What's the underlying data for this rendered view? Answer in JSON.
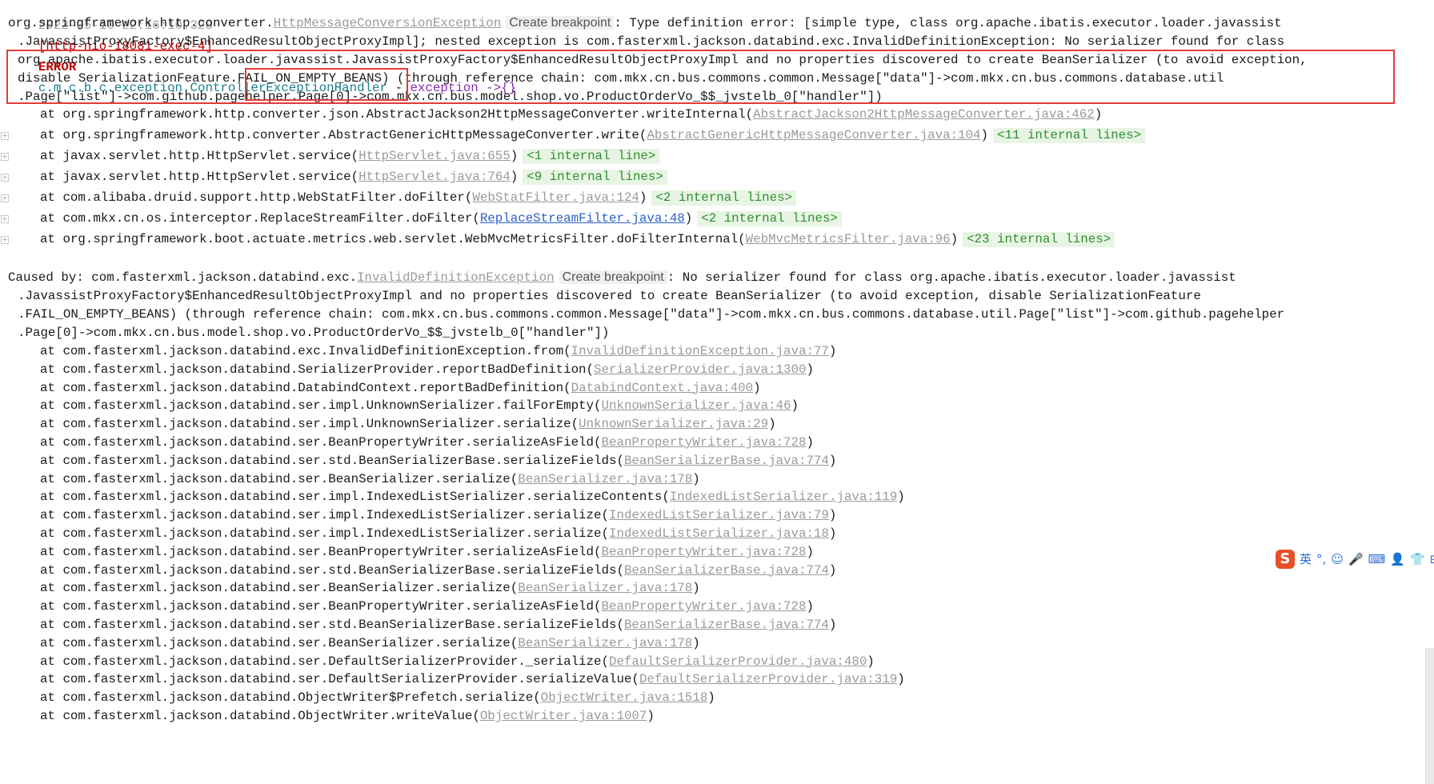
{
  "log_header": {
    "timestamp": "2022-05-10 22:16:10.328",
    "thread": "[http-nio-18081-exec-4]",
    "level": "ERROR",
    "logger": "c.m.c.b.c.exception.ControllerExceptionHandler",
    "separator": " - ",
    "message": "exception ->{}"
  },
  "exception": {
    "prefix": "org.springframework.http.converter.",
    "class_link": "HttpMessageConversionException",
    "create_breakpoint": "Create breakpoint",
    "line1_rest": ": Type definition error: [simple type, class org.apache.ibatis.executor.loader.javassist",
    "line2": ".JavassistProxyFactory$EnhancedResultObjectProxyImpl]; nested exception is com.fasterxml.jackson.databind.exc.InvalidDefinitionException: No serializer found for class",
    "line3": "org.apache.ibatis.executor.loader.javassist.JavassistProxyFactory$EnhancedResultObjectProxyImpl and no properties discovered to create BeanSerializer (to avoid exception,",
    "line4_a": "disable SerializationFeature.",
    "line4_b": "FAIL_ON_EMPTY_BEANS)",
    "line4_c": " (through reference chain: com.mkx.cn.bus.commons.common.Message[\"data\"]->com.mkx.cn.bus.commons.database.util",
    "line5": ".Page[\"list\"]->com.github.pagehelper.Page[0]->com.mkx.cn.bus.model.shop.vo.ProductOrderVo_$$_jvstelb_0[\"handler\"])"
  },
  "stack1": [
    {
      "method": "at org.springframework.http.converter.json.AbstractJackson2HttpMessageConverter.writeInternal",
      "file": "AbstractJackson2HttpMessageConverter.java:462",
      "internal": ""
    },
    {
      "method": "at org.springframework.http.converter.AbstractGenericHttpMessageConverter.write",
      "file": "AbstractGenericHttpMessageConverter.java:104",
      "internal": "<11 internal lines>"
    },
    {
      "method": "at javax.servlet.http.HttpServlet.service",
      "file": "HttpServlet.java:655",
      "internal": "<1 internal line>"
    },
    {
      "method": "at javax.servlet.http.HttpServlet.service",
      "file": "HttpServlet.java:764",
      "internal": "<9 internal lines>"
    },
    {
      "method": "at com.alibaba.druid.support.http.WebStatFilter.doFilter",
      "file": "WebStatFilter.java:124",
      "internal": "<2 internal lines>"
    },
    {
      "method": "at com.mkx.cn.os.interceptor.ReplaceStreamFilter.doFilter",
      "file": "ReplaceStreamFilter.java:48",
      "internal": "<2 internal lines>"
    },
    {
      "method": "at org.springframework.boot.actuate.metrics.web.servlet.WebMvcMetricsFilter.doFilterInternal",
      "file": "WebMvcMetricsFilter.java:96",
      "internal": "<23 internal lines>"
    }
  ],
  "caused_by": {
    "prefix": "Caused by: com.fasterxml.jackson.databind.exc.",
    "class_link": "InvalidDefinitionException",
    "create_breakpoint": "Create breakpoint",
    "line1_rest": ": No serializer found for class org.apache.ibatis.executor.loader.javassist",
    "line2": ".JavassistProxyFactory$EnhancedResultObjectProxyImpl and no properties discovered to create BeanSerializer (to avoid exception, disable SerializationFeature",
    "line3": ".FAIL_ON_EMPTY_BEANS) (through reference chain: com.mkx.cn.bus.commons.common.Message[\"data\"]->com.mkx.cn.bus.commons.database.util.Page[\"list\"]->com.github.pagehelper",
    "line4": ".Page[0]->com.mkx.cn.bus.model.shop.vo.ProductOrderVo_$$_jvstelb_0[\"handler\"])"
  },
  "stack2": [
    {
      "method": "at com.fasterxml.jackson.databind.exc.InvalidDefinitionException.from",
      "file": "InvalidDefinitionException.java:77"
    },
    {
      "method": "at com.fasterxml.jackson.databind.SerializerProvider.reportBadDefinition",
      "file": "SerializerProvider.java:1300"
    },
    {
      "method": "at com.fasterxml.jackson.databind.DatabindContext.reportBadDefinition",
      "file": "DatabindContext.java:400"
    },
    {
      "method": "at com.fasterxml.jackson.databind.ser.impl.UnknownSerializer.failForEmpty",
      "file": "UnknownSerializer.java:46"
    },
    {
      "method": "at com.fasterxml.jackson.databind.ser.impl.UnknownSerializer.serialize",
      "file": "UnknownSerializer.java:29"
    },
    {
      "method": "at com.fasterxml.jackson.databind.ser.BeanPropertyWriter.serializeAsField",
      "file": "BeanPropertyWriter.java:728"
    },
    {
      "method": "at com.fasterxml.jackson.databind.ser.std.BeanSerializerBase.serializeFields",
      "file": "BeanSerializerBase.java:774"
    },
    {
      "method": "at com.fasterxml.jackson.databind.ser.BeanSerializer.serialize",
      "file": "BeanSerializer.java:178"
    },
    {
      "method": "at com.fasterxml.jackson.databind.ser.impl.IndexedListSerializer.serializeContents",
      "file": "IndexedListSerializer.java:119"
    },
    {
      "method": "at com.fasterxml.jackson.databind.ser.impl.IndexedListSerializer.serialize",
      "file": "IndexedListSerializer.java:79"
    },
    {
      "method": "at com.fasterxml.jackson.databind.ser.impl.IndexedListSerializer.serialize",
      "file": "IndexedListSerializer.java:18"
    },
    {
      "method": "at com.fasterxml.jackson.databind.ser.BeanPropertyWriter.serializeAsField",
      "file": "BeanPropertyWriter.java:728"
    },
    {
      "method": "at com.fasterxml.jackson.databind.ser.std.BeanSerializerBase.serializeFields",
      "file": "BeanSerializerBase.java:774"
    },
    {
      "method": "at com.fasterxml.jackson.databind.ser.BeanSerializer.serialize",
      "file": "BeanSerializer.java:178"
    },
    {
      "method": "at com.fasterxml.jackson.databind.ser.BeanPropertyWriter.serializeAsField",
      "file": "BeanPropertyWriter.java:728"
    },
    {
      "method": "at com.fasterxml.jackson.databind.ser.std.BeanSerializerBase.serializeFields",
      "file": "BeanSerializerBase.java:774"
    },
    {
      "method": "at com.fasterxml.jackson.databind.ser.BeanSerializer.serialize",
      "file": "BeanSerializer.java:178"
    },
    {
      "method": "at com.fasterxml.jackson.databind.ser.DefaultSerializerProvider._serialize",
      "file": "DefaultSerializerProvider.java:480"
    },
    {
      "method": "at com.fasterxml.jackson.databind.ser.DefaultSerializerProvider.serializeValue",
      "file": "DefaultSerializerProvider.java:319"
    },
    {
      "method": "at com.fasterxml.jackson.databind.ObjectWriter$Prefetch.serialize",
      "file": "ObjectWriter.java:1518"
    },
    {
      "method": "at com.fasterxml.jackson.databind.ObjectWriter.writeValue",
      "file": "ObjectWriter.java:1007"
    }
  ],
  "ime_toolbar": {
    "logo": "S",
    "lang": "英",
    "items": [
      "°,",
      "☺",
      "🎤",
      "⌨",
      "👤",
      "👕",
      "⊞"
    ]
  },
  "colors": {
    "highlight_box": "#e23b3b",
    "error_level": "#c00000",
    "thread": "#b00000",
    "logger": "#1a7f8e",
    "message": "#8b2bb5",
    "internal_lines": "#2f8f2f",
    "internal_bg": "#e8f5e4",
    "file_link": "#9a9a9a",
    "visited_link": "#2a5fc8"
  }
}
